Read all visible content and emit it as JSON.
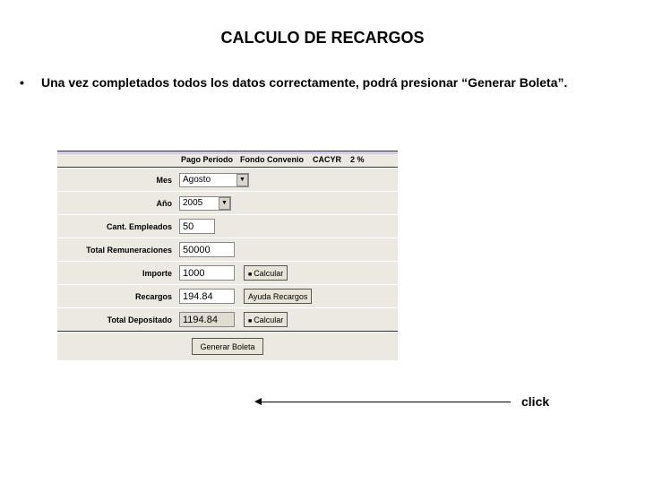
{
  "title": "CALCULO DE RECARGOS",
  "bullet": "•",
  "bullet_text": "Una vez completados todos los datos correctamente, podrá presionar “Generar Boleta”.",
  "header": {
    "c1": "Pago Período",
    "c2": "Fondo Convenio",
    "c3": "CACYR",
    "c4": "2 %"
  },
  "labels": {
    "mes": "Mes",
    "anio": "Año",
    "cant": "Cant. Empleados",
    "total_rem": "Total Remuneraciones",
    "importe": "Importe",
    "recargos": "Recargos",
    "total_dep": "Total Depositado"
  },
  "values": {
    "mes": "Agosto",
    "anio": "2005",
    "cant": "50",
    "total_rem": "50000",
    "importe": "1000",
    "recargos": "194.84",
    "total_dep": "1194.84"
  },
  "buttons": {
    "calcular": "Calcular",
    "ayuda": "Ayuda Recargos",
    "generar": "Generar Boleta"
  },
  "annotation": "click"
}
